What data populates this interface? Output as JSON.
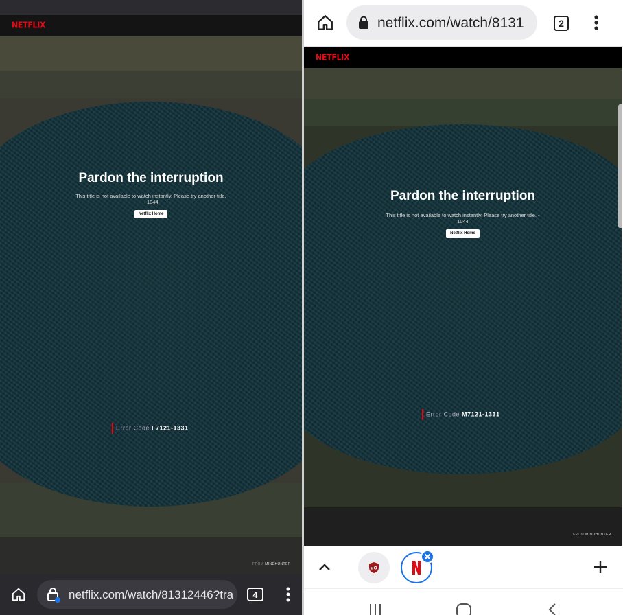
{
  "left": {
    "brand": "NETFLIX",
    "error_title": "Pardon the interruption",
    "error_message": "This title is not available to watch instantly. Please try another title.",
    "error_number": "- 1044",
    "home_button": "Netflix Home",
    "error_code_label": "Error Code",
    "error_code": "F7121-1331",
    "from_label": "FROM",
    "from_title": "MINDHUNTER",
    "url": "netflix.com/watch/81312446?tra",
    "tab_count": "4",
    "icons": {
      "home": "home-icon",
      "lock": "lock-icon",
      "menu": "more-vert-icon"
    }
  },
  "right": {
    "url": "netflix.com/watch/8131",
    "tab_count": "2",
    "brand": "NETFLIX",
    "error_title": "Pardon the interruption",
    "error_message": "This title is not available to watch instantly. Please try another title. -",
    "error_number": "1044",
    "home_button": "Netflix Home",
    "error_code_label": "Error Code",
    "error_code": "M7121-1331",
    "from_label": "FROM",
    "from_title": "MINDHUNTER",
    "tab_strip": {
      "collapse": "chevron-up-icon",
      "tabs": [
        "ublock-tab",
        "netflix-tab"
      ],
      "new_tab": "+"
    },
    "icons": {
      "home": "home-icon",
      "lock": "lock-icon",
      "menu": "more-vert-icon"
    }
  },
  "colors": {
    "netflix_red": "#e50914",
    "accent_blue": "#1a73e8"
  }
}
